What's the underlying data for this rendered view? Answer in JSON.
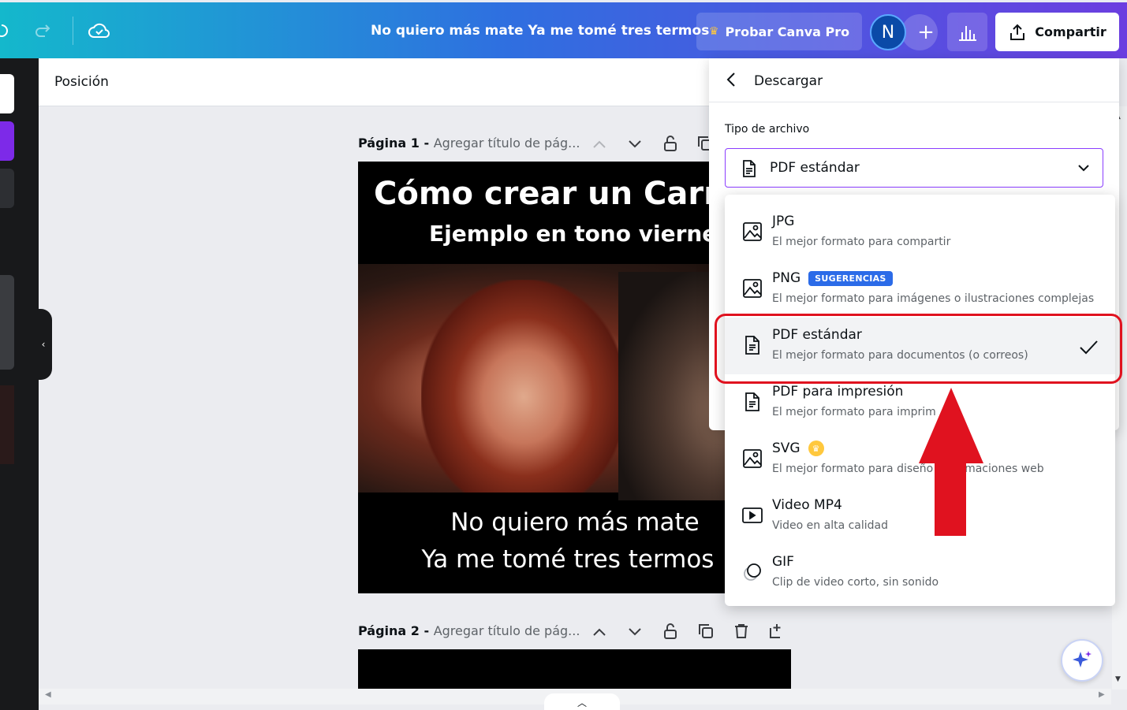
{
  "topbar": {
    "doc_title": "No quiero más mate Ya me tomé tres termos",
    "pro_label": "Probar Canva Pro",
    "avatar_initial": "N",
    "share_label": "Compartir"
  },
  "position_bar": {
    "label": "Posición"
  },
  "pages": [
    {
      "label": "Página 1 - ",
      "title_placeholder": "Agregar título de pág..."
    },
    {
      "label": "Página 2 - ",
      "title_placeholder": "Agregar título de pág..."
    }
  ],
  "canvas1": {
    "title": "Cómo crear un Carr",
    "subtitle": "Ejemplo en tono viernes",
    "caption_line1": "No quiero más mate",
    "caption_line2": "Ya me tomé tres termos"
  },
  "download_panel": {
    "title": "Descargar",
    "file_type_label": "Tipo de archivo",
    "selected_value": "PDF estándar"
  },
  "file_options": [
    {
      "name": "JPG",
      "desc": "El mejor formato para compartir",
      "icon": "image-icon"
    },
    {
      "name": "PNG",
      "badge": "SUGERENCIAS",
      "desc": "El mejor formato para imágenes o ilustraciones complejas",
      "icon": "image-icon"
    },
    {
      "name": "PDF estándar",
      "desc": "El mejor formato para documentos (o correos)",
      "icon": "document-icon",
      "selected": true
    },
    {
      "name": "PDF para impresión",
      "desc": "El mejor formato para imprim",
      "icon": "document-icon"
    },
    {
      "name": "SVG",
      "desc": "El mejor formato para diseño",
      "desc_tail": "imaciones web",
      "icon": "image-icon",
      "pro": true
    },
    {
      "name": "Video MP4",
      "desc": "Video en alta calidad",
      "icon": "video-icon"
    },
    {
      "name": "GIF",
      "desc": "Clip de video corto, sin sonido",
      "icon": "gif-icon"
    }
  ],
  "colors": {
    "accent_purple": "#8b3dff",
    "badge_blue": "#2b6be8",
    "annotation_red": "#e0121f",
    "topbar_start": "#14b8cc",
    "topbar_end": "#6b3ee0"
  }
}
